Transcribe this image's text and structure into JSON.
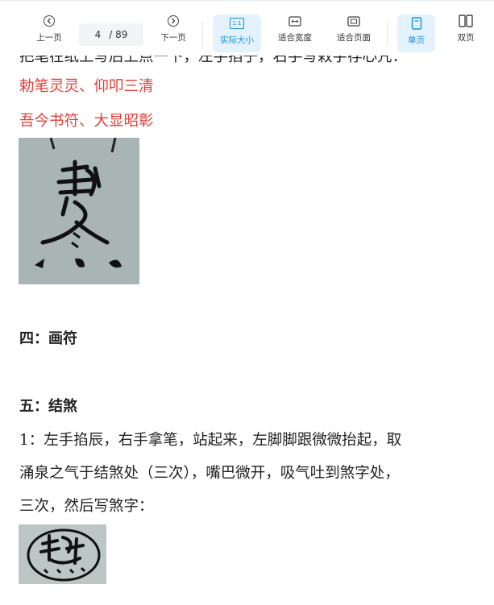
{
  "toolbar": {
    "prev_label": "上一页",
    "current_page": "4",
    "total_pages": "/ 89",
    "next_label": "下一页",
    "actual_size_label": "实际大小",
    "actual_size_icon_text": "1:1",
    "fit_width_label": "适合宽度",
    "fit_page_label": "适合页面",
    "single_page_label": "单页",
    "double_page_label": "双页",
    "active_color": "#1a8ee0"
  },
  "document": {
    "partial_top_line": "把笔在纸上写后上点一下，左手掐子，右手写敕字存心咒：",
    "red_line_1": "勅笔灵灵、仰叩三清",
    "red_line_2": "吾今书符、大显昭彰",
    "section_4": "四：画符",
    "section_5": "五：结煞",
    "para_line_1": "1：左手掐辰，右手拿笔，站起来，左脚脚跟微微抬起，取",
    "para_line_2": "涌泉之气于结煞处（三次），嘴巴微开，吸气吐到煞字处，",
    "para_line_3": "三次，然后写煞字：",
    "red_color": "#e2403a"
  }
}
